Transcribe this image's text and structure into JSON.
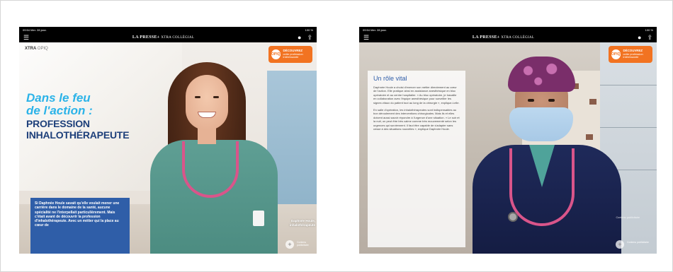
{
  "status_bar": {
    "time": "09:54",
    "date": "Mer. 28 janv.",
    "battery": "100 %"
  },
  "nav": {
    "brand": "LA PRESSE+",
    "brand_sub": "XTRA COLLÈGIAL"
  },
  "left_page": {
    "tag_brand": "XTRA",
    "tag_sub": "OPIQ",
    "badge_icon": "OPIQ",
    "badge_title": "DÉCOUVREZ",
    "badge_sub": "cette profession intéressante",
    "title_italic_line1": "Dans le feu",
    "title_italic_line2": "de l'action :",
    "title_main_line1": "PROFESSION",
    "title_main_line2": "INHALOTHÉRAPEUTE",
    "intro_text": "Si Daphnée Houle savait qu'elle voulait mener une carrière dans le domaine de la santé, aucune spécialité ne l'interpellait particulièrement. Mais c'était avant de découvrir la profession d'inhalothérapeute. Avec un métier qui la place au cœur de",
    "caption_name": "Daphnée Houle,",
    "caption_role": "inhalothérapeute",
    "corner_plus": "+",
    "corner_text": "Contenu publicitaire"
  },
  "right_page": {
    "badge_icon": "OPIQ",
    "badge_title": "DÉCOUVREZ",
    "badge_sub": "cette profession intéressante",
    "panel_title": "Un rôle vital",
    "paragraph1": "Daphnée Houle a choisi d'exercer son métier directement au cœur de l'action. Elle pratique ainsi en assistance anesthésique en bloc opératoire et au centre hospitalier. « Au bloc opératoire, je travaille en collaboration avec l'équipe anesthésique pour surveiller les signes vitaux du patient tout au long de la chirurgie », explique-t-elle.",
    "paragraph2": "En salle d'opération, les inhalothérapeutes sont indispensables au bon déroulement des interventions chirurgicales. Mais ils et elles doivent aussi savoir répondre à l'urgence d'une situation. « Le soir et la nuit, on peut être très calme comme très mouvementé selon les urgences qui surviennent. Il faut être capable de s'adapter sans cesse à des situations nouvelles », explique Daphnée Houle.",
    "caption": "Contenu publicitaire",
    "corner_plus": "+",
    "corner_text": "Contenu publicitaire"
  },
  "colors": {
    "accent_cyan": "#2bb3e8",
    "title_navy": "#1d3f7a",
    "box_blue": "#2f5ea8",
    "badge_orange": "#f27321",
    "stethoscope_pink": "#d9558a"
  },
  "icons": {
    "menu": "hamburger-icon",
    "account": "user-icon",
    "share": "share-icon"
  }
}
